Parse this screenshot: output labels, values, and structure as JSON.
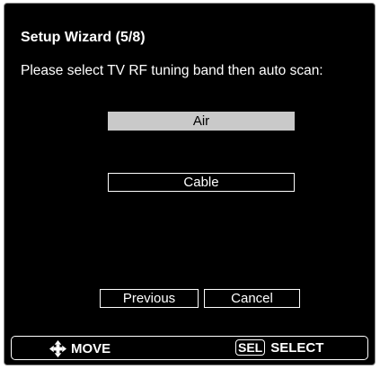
{
  "wizard": {
    "title": "Setup Wizard (5/8)",
    "prompt": "Please select TV RF tuning band then auto scan:"
  },
  "options": [
    {
      "label": "Air",
      "selected": true
    },
    {
      "label": "Cable",
      "selected": false
    }
  ],
  "buttons": {
    "previous_label": "Previous",
    "cancel_label": "Cancel"
  },
  "hints": {
    "move_icon": "dpad-arrows-icon",
    "move_label": "MOVE",
    "sel_key_label": "SEL",
    "select_label": "SELECT"
  },
  "colors": {
    "background": "#000000",
    "text": "#ffffff",
    "selected_bg": "#c9c9c9",
    "border": "#ffffff"
  }
}
